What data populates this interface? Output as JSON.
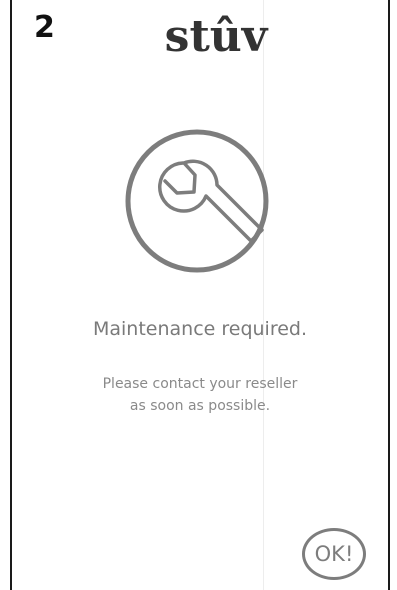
{
  "screen": {
    "number": "2",
    "brand": "stûv",
    "icon": "wrench-icon",
    "title": "Maintenance required.",
    "message_lines": [
      "Please contact your reseller",
      "as soon as possible."
    ],
    "ok_label": "OK!"
  },
  "colors": {
    "background": "#ffffff",
    "text_gray": "#7a7a7a",
    "icon_gray": "#7d7d7d",
    "logo": "#333333",
    "border": "#1a1a1a"
  }
}
